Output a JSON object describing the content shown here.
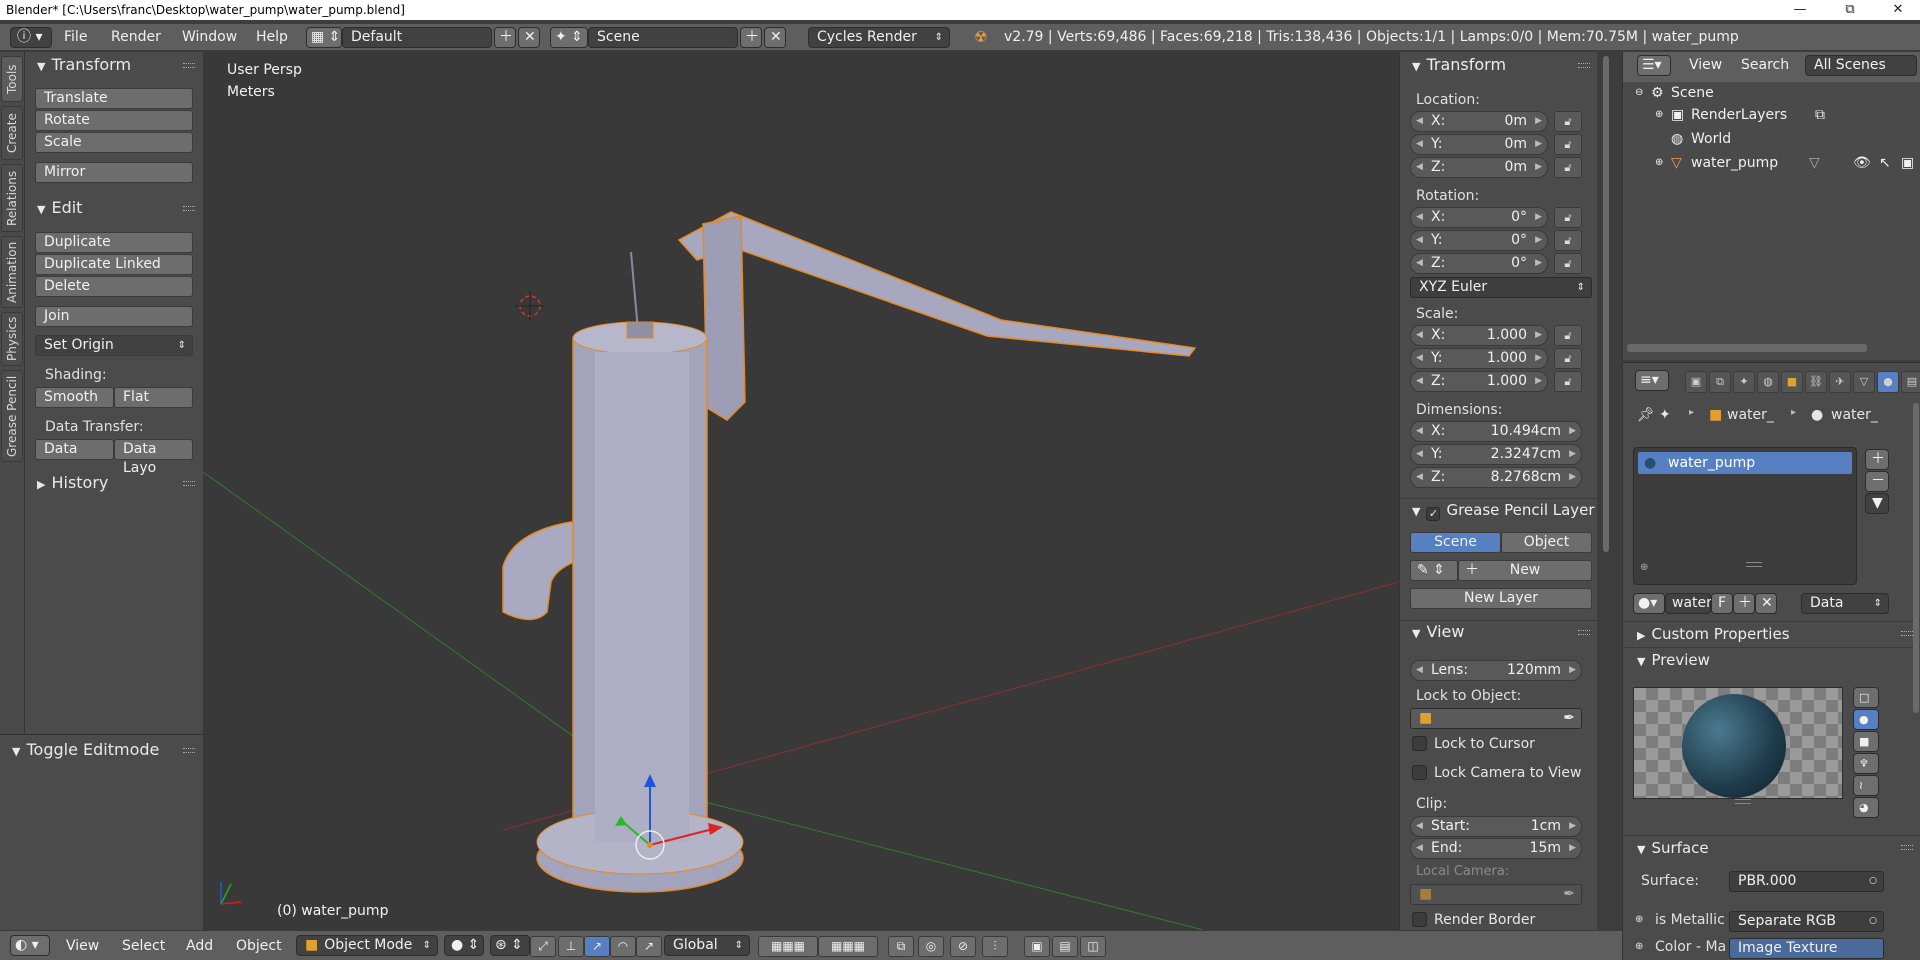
{
  "window": {
    "title": "Blender* [C:\\Users\\franc\\Desktop\\water_pump\\water_pump.blend]",
    "minimize": "—",
    "maximize": "⧉",
    "close": "✕"
  },
  "info_header": {
    "menus": [
      "File",
      "Render",
      "Window",
      "Help"
    ],
    "layout": "Default",
    "scene": "Scene",
    "engine": "Cycles Render",
    "stats": "v2.79 | Verts:69,486 | Faces:69,218 | Tris:138,436 | Objects:1/1 | Lamps:0/0 | Mem:70.75M | water_pump"
  },
  "tool_tabs": [
    "Tools",
    "Create",
    "Relations",
    "Animation",
    "Physics",
    "Grease Pencil"
  ],
  "tool_shelf": {
    "transform_header": "Transform",
    "translate": "Translate",
    "rotate": "Rotate",
    "scale": "Scale",
    "mirror": "Mirror",
    "edit_header": "Edit",
    "duplicate": "Duplicate",
    "duplicate_linked": "Duplicate Linked",
    "delete": "Delete",
    "join": "Join",
    "set_origin": "Set Origin",
    "shading_label": "Shading:",
    "smooth": "Smooth",
    "flat": "Flat",
    "data_transfer_label": "Data Transfer:",
    "data": "Data",
    "data_layout": "Data Layo",
    "history_header": "History"
  },
  "operator_panel": {
    "header": "Toggle Editmode"
  },
  "viewport": {
    "view_name": "User Persp",
    "units": "Meters",
    "object_label": "(0) water_pump"
  },
  "n_panel": {
    "transform_header": "Transform",
    "location_label": "Location:",
    "location": {
      "x": "0m",
      "y": "0m",
      "z": "0m"
    },
    "rotation_label": "Rotation:",
    "rotation": {
      "x": "0°",
      "y": "0°",
      "z": "0°"
    },
    "rotation_mode": "XYZ Euler",
    "scale_label": "Scale:",
    "scale": {
      "x": "1.000",
      "y": "1.000",
      "z": "1.000"
    },
    "dimensions_label": "Dimensions:",
    "dimensions": {
      "x": "10.494cm",
      "y": "2.3247cm",
      "z": "8.2768cm"
    },
    "axis_x": "X:",
    "axis_y": "Y:",
    "axis_z": "Z:",
    "gp_header": "Grease Pencil Layer",
    "gp_scene": "Scene",
    "gp_object": "Object",
    "gp_new": "New",
    "gp_new_layer": "New Layer",
    "view_header": "View",
    "lens_label": "Lens:",
    "lens_value": "120mm",
    "lock_to_object": "Lock to Object:",
    "lock_to_cursor": "Lock to Cursor",
    "lock_camera": "Lock Camera to View",
    "clip_label": "Clip:",
    "clip_start_label": "Start:",
    "clip_start": "1cm",
    "clip_end_label": "End:",
    "clip_end": "15m",
    "local_camera": "Local Camera:",
    "render_border": "Render Border"
  },
  "outliner": {
    "view": "View",
    "search": "Search",
    "filter": "All Scenes",
    "items": [
      "Scene",
      "RenderLayers",
      "World",
      "water_pump"
    ]
  },
  "properties": {
    "breadcrumb_obj": "water_",
    "breadcrumb_mat": "water_",
    "material_slot": "water_pump",
    "mat_name": "water",
    "mat_f": "F",
    "link": "Data",
    "custom_props": "Custom Properties",
    "preview": "Preview",
    "surface_header": "Surface",
    "surface_label": "Surface:",
    "surface_value": "PBR.000",
    "metallic_label": "is Metallic",
    "metallic_value": "Separate RGB",
    "color_label": "Color - Ma",
    "color_value": "Image Texture"
  },
  "bottom_header": {
    "menus": [
      "View",
      "Select",
      "Add",
      "Object"
    ],
    "mode": "Object Mode",
    "orientation": "Global"
  },
  "colors": {
    "selection_outline": "#e8891c",
    "active_blue": "#5680c2",
    "model": "#a7a8bf"
  }
}
